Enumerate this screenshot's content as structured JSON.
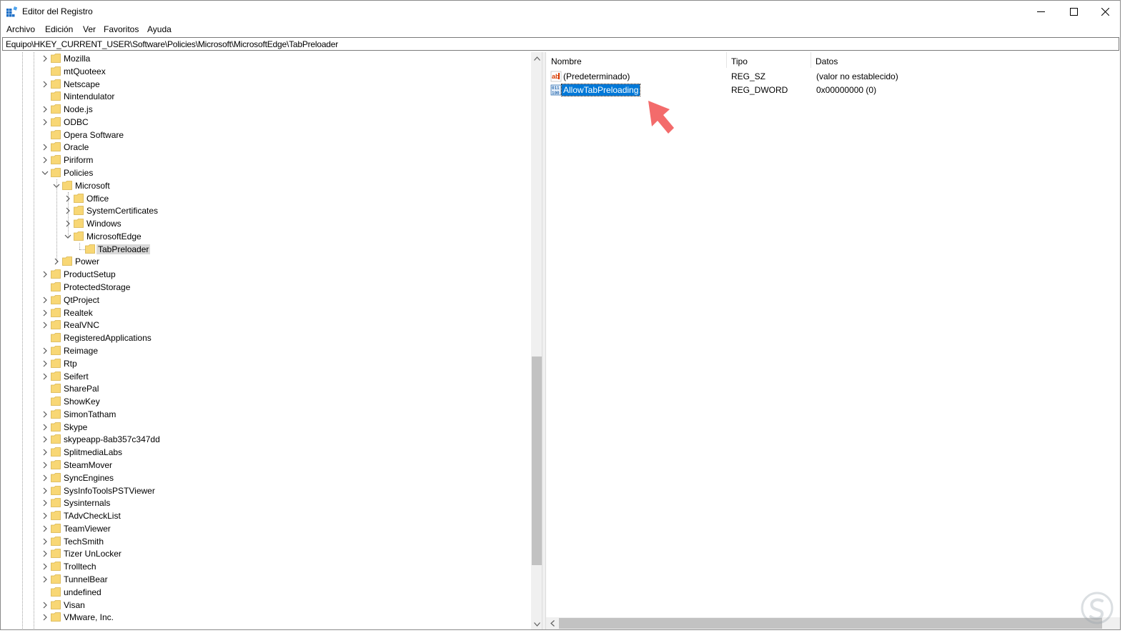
{
  "window": {
    "title": "Editor del Registro",
    "app_icon": "registry-editor-icon",
    "controls": [
      "minimize-icon",
      "maximize-icon",
      "close-icon"
    ]
  },
  "menu": [
    "Archivo",
    "Edición",
    "Ver",
    "Favoritos",
    "Ayuda"
  ],
  "address": "Equipo\\HKEY_CURRENT_USER\\Software\\Policies\\Microsoft\\MicrosoftEdge\\TabPreloader",
  "tree": [
    {
      "label": "Mozilla",
      "level": 0,
      "state": "collapsed"
    },
    {
      "label": "mtQuoteex",
      "level": 0,
      "state": "leaf"
    },
    {
      "label": "Netscape",
      "level": 0,
      "state": "collapsed"
    },
    {
      "label": "Nintendulator",
      "level": 0,
      "state": "leaf"
    },
    {
      "label": "Node.js",
      "level": 0,
      "state": "collapsed"
    },
    {
      "label": "ODBC",
      "level": 0,
      "state": "collapsed"
    },
    {
      "label": "Opera Software",
      "level": 0,
      "state": "leaf"
    },
    {
      "label": "Oracle",
      "level": 0,
      "state": "collapsed"
    },
    {
      "label": "Piriform",
      "level": 0,
      "state": "collapsed"
    },
    {
      "label": "Policies",
      "level": 0,
      "state": "expanded"
    },
    {
      "label": "Microsoft",
      "level": 1,
      "state": "expanded"
    },
    {
      "label": "Office",
      "level": 2,
      "state": "collapsed"
    },
    {
      "label": "SystemCertificates",
      "level": 2,
      "state": "collapsed"
    },
    {
      "label": "Windows",
      "level": 2,
      "state": "collapsed"
    },
    {
      "label": "MicrosoftEdge",
      "level": 2,
      "state": "expanded"
    },
    {
      "label": "TabPreloader",
      "level": 3,
      "state": "leaf",
      "selected": true
    },
    {
      "label": "Power",
      "level": 1,
      "state": "collapsed"
    },
    {
      "label": "ProductSetup",
      "level": 0,
      "state": "collapsed"
    },
    {
      "label": "ProtectedStorage",
      "level": 0,
      "state": "leaf"
    },
    {
      "label": "QtProject",
      "level": 0,
      "state": "collapsed"
    },
    {
      "label": "Realtek",
      "level": 0,
      "state": "collapsed"
    },
    {
      "label": "RealVNC",
      "level": 0,
      "state": "collapsed"
    },
    {
      "label": "RegisteredApplications",
      "level": 0,
      "state": "leaf"
    },
    {
      "label": "Reimage",
      "level": 0,
      "state": "collapsed"
    },
    {
      "label": "Rtp",
      "level": 0,
      "state": "collapsed"
    },
    {
      "label": "Seifert",
      "level": 0,
      "state": "collapsed"
    },
    {
      "label": "SharePal",
      "level": 0,
      "state": "leaf"
    },
    {
      "label": "ShowKey",
      "level": 0,
      "state": "leaf"
    },
    {
      "label": "SimonTatham",
      "level": 0,
      "state": "collapsed"
    },
    {
      "label": "Skype",
      "level": 0,
      "state": "collapsed"
    },
    {
      "label": "skypeapp-8ab357c347dd",
      "level": 0,
      "state": "collapsed"
    },
    {
      "label": "SplitmediaLabs",
      "level": 0,
      "state": "collapsed"
    },
    {
      "label": "SteamMover",
      "level": 0,
      "state": "collapsed"
    },
    {
      "label": "SyncEngines",
      "level": 0,
      "state": "collapsed"
    },
    {
      "label": "SysInfoToolsPSTViewer",
      "level": 0,
      "state": "collapsed"
    },
    {
      "label": "Sysinternals",
      "level": 0,
      "state": "collapsed"
    },
    {
      "label": "TAdvCheckList",
      "level": 0,
      "state": "collapsed"
    },
    {
      "label": "TeamViewer",
      "level": 0,
      "state": "collapsed"
    },
    {
      "label": "TechSmith",
      "level": 0,
      "state": "collapsed"
    },
    {
      "label": "Tizer UnLocker",
      "level": 0,
      "state": "collapsed"
    },
    {
      "label": "Trolltech",
      "level": 0,
      "state": "collapsed"
    },
    {
      "label": "TunnelBear",
      "level": 0,
      "state": "collapsed"
    },
    {
      "label": "undefined",
      "level": 0,
      "state": "leaf"
    },
    {
      "label": "Visan",
      "level": 0,
      "state": "collapsed"
    },
    {
      "label": "VMware, Inc.",
      "level": 0,
      "state": "collapsed"
    }
  ],
  "columns": [
    "Nombre",
    "Tipo",
    "Datos"
  ],
  "values": [
    {
      "name": "(Predeterminado)",
      "type": "REG_SZ",
      "data": "(valor no establecido)",
      "icon": "string-value-icon",
      "selected": false
    },
    {
      "name": "AllowTabPreloading",
      "type": "REG_DWORD",
      "data": "0x00000000 (0)",
      "icon": "dword-value-icon",
      "selected": true
    }
  ],
  "colors": {
    "selection": "#0078d7",
    "tree_selection": "#d9d9d9",
    "folder": "#f8d775",
    "annotation_arrow": "#f36b6b"
  }
}
